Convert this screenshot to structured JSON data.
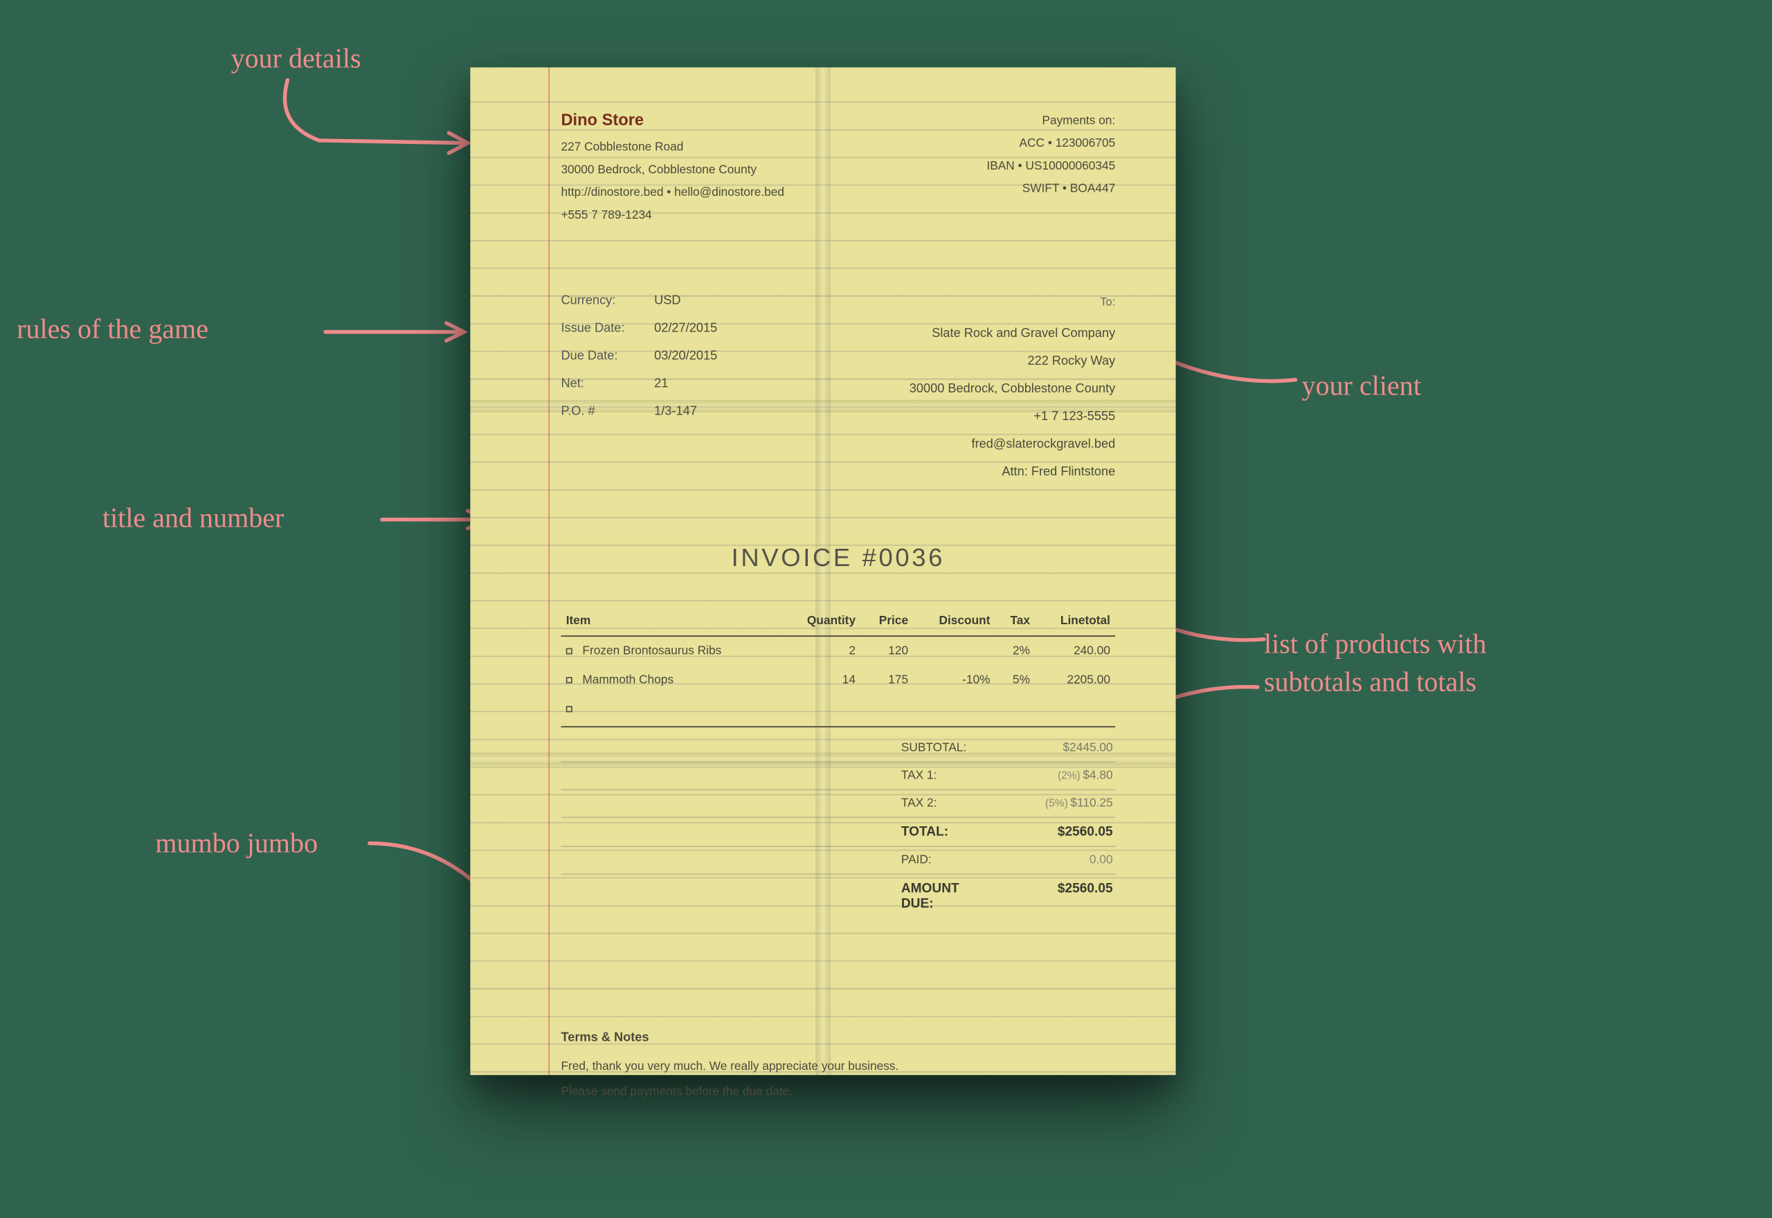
{
  "annotations": {
    "your_details": "your details",
    "rules": "rules of the game",
    "title_number": "title and number",
    "mumbo": "mumbo jumbo",
    "your_client": "your client",
    "products": "list of products with",
    "products2": "subtotals  and totals"
  },
  "store": {
    "name": "Dino Store",
    "line1": "227 Cobblestone Road",
    "line2": "30000 Bedrock, Cobblestone County",
    "line3": "http://dinostore.bed • hello@dinostore.bed",
    "line4": "+555 7 789-1234"
  },
  "payments": {
    "title": "Payments on:",
    "acc": "ACC • 123006705",
    "iban": "IBAN • US10000060345",
    "swift": "SWIFT • BOA447"
  },
  "meta": {
    "labels": {
      "currency": "Currency:",
      "issue": "Issue Date:",
      "due": "Due Date:",
      "net": "Net:",
      "po": "P.O. #"
    },
    "values": {
      "currency": "USD",
      "issue": "02/27/2015",
      "due": "03/20/2015",
      "net": "21",
      "po": "1/3-147"
    }
  },
  "client": {
    "to": "To:",
    "name": "Slate Rock and Gravel Company",
    "line1": "222 Rocky Way",
    "line2": "30000 Bedrock, Cobblestone County",
    "phone": "+1 7 123-5555",
    "email": "fred@slaterockgravel.bed",
    "attn": "Attn: Fred Flintstone"
  },
  "title": "INVOICE  #0036",
  "table": {
    "headers": {
      "item": "Item",
      "qty": "Quantity",
      "price": "Price",
      "discount": "Discount",
      "tax": "Tax",
      "total": "Linetotal"
    },
    "rows": [
      {
        "item": "Frozen Brontosaurus Ribs",
        "qty": "2",
        "price": "120",
        "discount": "",
        "tax": "2%",
        "total": "240.00"
      },
      {
        "item": "Mammoth Chops",
        "qty": "14",
        "price": "175",
        "discount": "-10%",
        "tax": "5%",
        "total": "2205.00"
      }
    ]
  },
  "totals": {
    "subtotal_lbl": "SUBTOTAL:",
    "subtotal": "$2445.00",
    "tax1_lbl": "TAX 1:",
    "tax1_pct": "(2%)",
    "tax1": "$4.80",
    "tax2_lbl": "TAX 2:",
    "tax2_pct": "(5%)",
    "tax2": "$110.25",
    "total_lbl": "TOTAL:",
    "total": "$2560.05",
    "paid_lbl": "PAID:",
    "paid": "0.00",
    "due_lbl": "AMOUNT DUE:",
    "due": "$2560.05"
  },
  "notes": {
    "title": "Terms & Notes",
    "p1": "Fred, thank you very much. We really appreciate your business.",
    "p2": "Please send payments before the due date."
  }
}
